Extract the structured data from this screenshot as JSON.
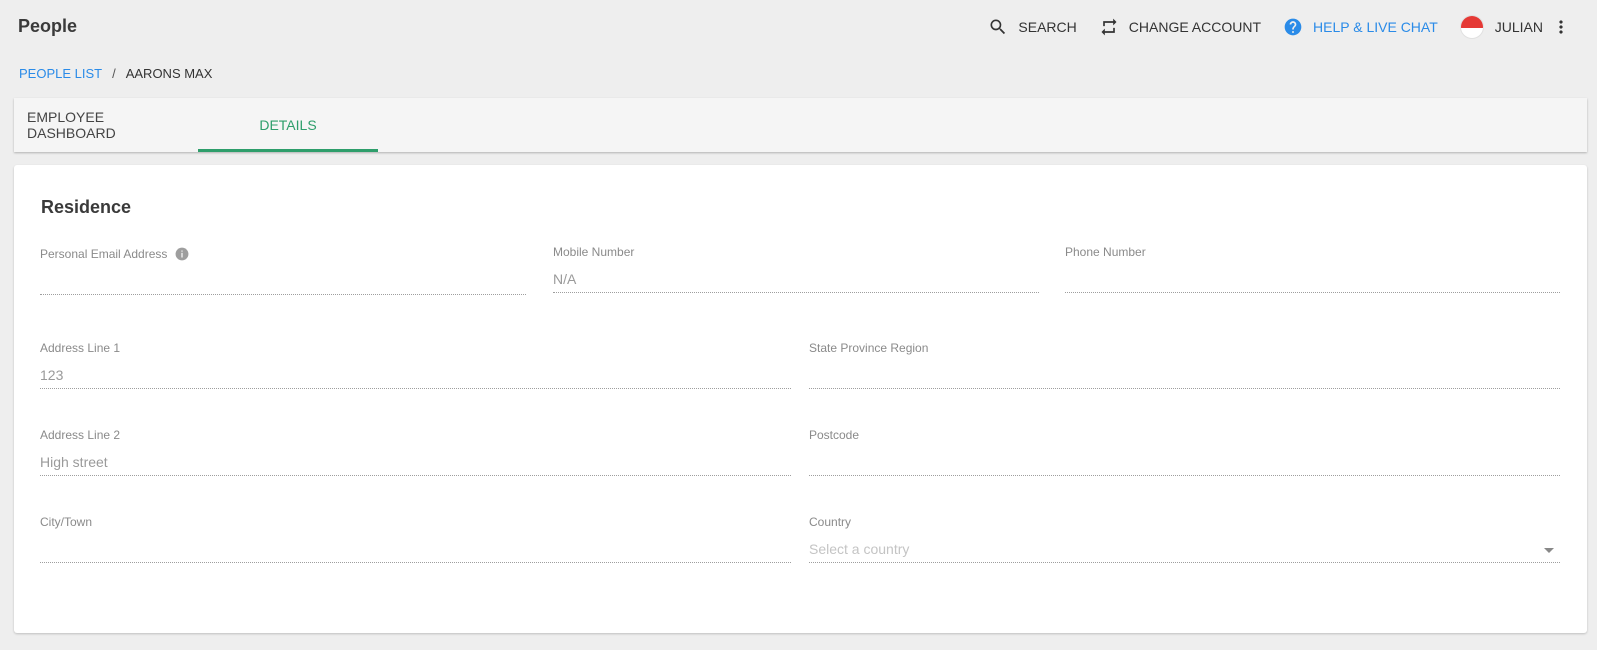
{
  "app": {
    "title": "People"
  },
  "topbar": {
    "search_label": "SEARCH",
    "change_account_label": "CHANGE ACCOUNT",
    "help_label": "HELP & LIVE CHAT",
    "user_name": "JULIAN"
  },
  "breadcrumb": {
    "parent": "PEOPLE LIST",
    "separator": "/",
    "current": "AARONS MAX"
  },
  "tabs": [
    {
      "label": "EMPLOYEE DASHBOARD",
      "active": false
    },
    {
      "label": "DETAILS",
      "active": true
    }
  ],
  "section": {
    "title": "Residence"
  },
  "fields": {
    "personal_email": {
      "label": "Personal Email Address",
      "value": ""
    },
    "mobile_number": {
      "label": "Mobile Number",
      "value": "N/A"
    },
    "phone_number": {
      "label": "Phone Number",
      "value": ""
    },
    "address_line_1": {
      "label": "Address Line 1",
      "value": "123"
    },
    "state_province_region": {
      "label": "State Province Region",
      "value": ""
    },
    "address_line_2": {
      "label": "Address Line 2",
      "value": "High street"
    },
    "postcode": {
      "label": "Postcode",
      "value": ""
    },
    "city_town": {
      "label": "City/Town",
      "value": ""
    },
    "country": {
      "label": "Country",
      "value": "",
      "placeholder": "Select a country"
    }
  },
  "colors": {
    "accent_green": "#2e9e6b",
    "link_blue": "#2a8be8",
    "background": "#eeeeee"
  },
  "icons": {
    "search": "search-icon",
    "change_account": "swap-icon",
    "help": "help-circle-icon",
    "avatar": "flag-avatar",
    "menu": "kebab-menu-icon",
    "info": "info-icon",
    "dropdown": "chevron-down-icon"
  }
}
